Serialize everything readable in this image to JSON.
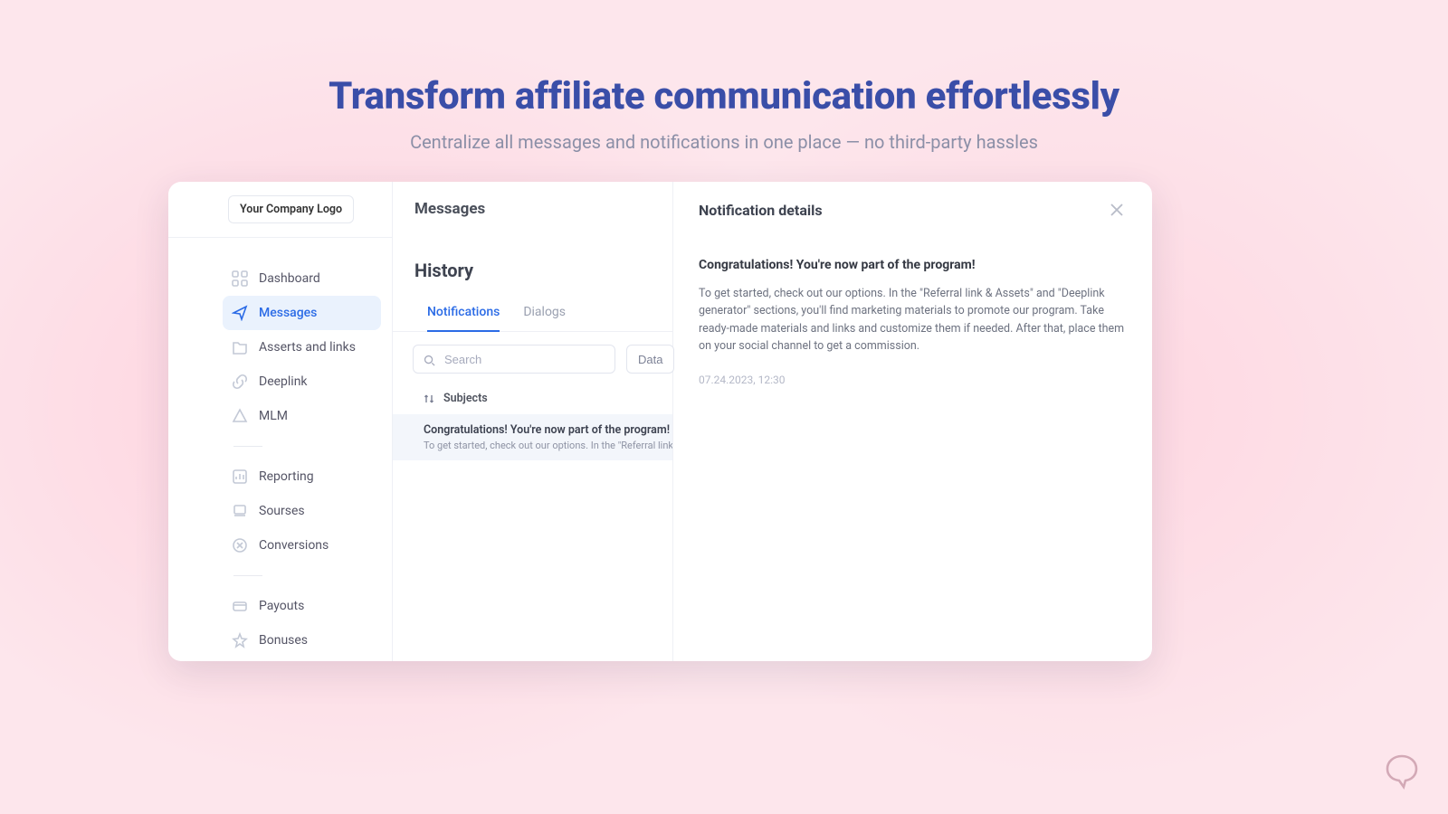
{
  "hero": {
    "title": "Transform affiliate communication effortlessly",
    "subtitle": "Centralize all messages and notifications in one place — no third-party hassles"
  },
  "logo": {
    "label": "Your Company Logo"
  },
  "nav": {
    "group1": [
      {
        "key": "dashboard",
        "label": "Dashboard"
      },
      {
        "key": "messages",
        "label": "Messages"
      },
      {
        "key": "assets",
        "label": "Asserts and links"
      },
      {
        "key": "deeplink",
        "label": "Deeplink"
      },
      {
        "key": "mlm",
        "label": "MLM"
      }
    ],
    "group2": [
      {
        "key": "reporting",
        "label": "Reporting"
      },
      {
        "key": "sources",
        "label": "Sourses"
      },
      {
        "key": "conversions",
        "label": "Conversions"
      }
    ],
    "group3": [
      {
        "key": "payouts",
        "label": "Payouts"
      },
      {
        "key": "bonuses",
        "label": "Bonuses"
      }
    ],
    "active": "messages"
  },
  "messages": {
    "title": "Messages",
    "history_title": "History",
    "tabs": {
      "notifications": "Notifications",
      "dialogs": "Dialogs"
    },
    "active_tab": "notifications",
    "search_placeholder": "Search",
    "data_button": "Data",
    "subjects_label": "Subjects",
    "rows": [
      {
        "subject": "Congratulations! You're now part of the program!",
        "preview": "To get started, check out our options. In the \"Referral link & Assets\" a"
      }
    ]
  },
  "detail": {
    "panel_title": "Notification details",
    "subject": "Congratulations! You're now part of the program!",
    "body": "To get started, check out our options. In the \"Referral link & Assets\" and \"Deeplink generator\" sections, you'll find marketing materials to promote our program. Take ready-made materials and links and customize them if needed. After that, place them on your social channel to get a commission.",
    "date": "07.24.2023, 12:30"
  }
}
